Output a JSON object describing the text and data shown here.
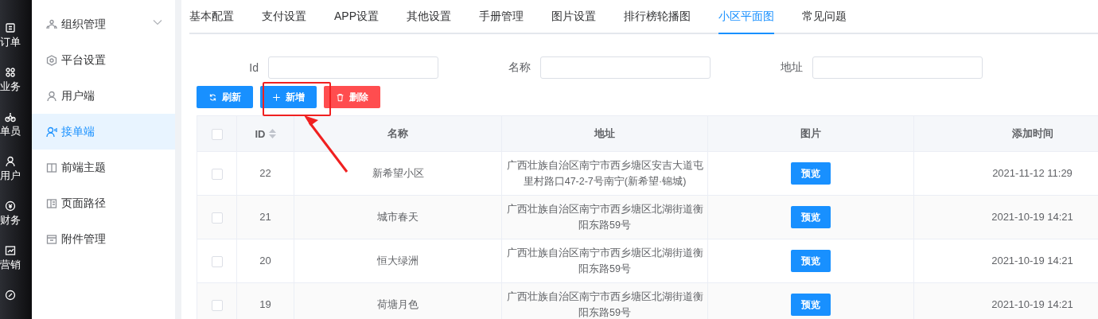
{
  "rail": [
    {
      "label": "订单"
    },
    {
      "label": "业务"
    },
    {
      "label": "单员"
    },
    {
      "label": "用户"
    },
    {
      "label": "财务"
    },
    {
      "label": "营销"
    }
  ],
  "sidebar": {
    "items": [
      {
        "label": "组织管理",
        "kind": "group",
        "selected": false
      },
      {
        "label": "平台设置",
        "kind": "link",
        "selected": false
      },
      {
        "label": "用户端",
        "kind": "link",
        "selected": false
      },
      {
        "label": "接单端",
        "kind": "link",
        "selected": true
      },
      {
        "label": "前端主题",
        "kind": "link",
        "selected": false
      },
      {
        "label": "页面路径",
        "kind": "link",
        "selected": false
      },
      {
        "label": "附件管理",
        "kind": "link",
        "selected": false
      }
    ]
  },
  "tabs": [
    {
      "label": "基本配置",
      "selected": false
    },
    {
      "label": "支付设置",
      "selected": false
    },
    {
      "label": "APP设置",
      "selected": false
    },
    {
      "label": "其他设置",
      "selected": false
    },
    {
      "label": "手册管理",
      "selected": false
    },
    {
      "label": "图片设置",
      "selected": false
    },
    {
      "label": "排行榜轮播图",
      "selected": false
    },
    {
      "label": "小区平面图",
      "selected": true
    },
    {
      "label": "常见问题",
      "selected": false
    }
  ],
  "filters": [
    {
      "label": "Id"
    },
    {
      "label": "名称"
    },
    {
      "label": "地址"
    }
  ],
  "buttons": [
    {
      "label": "刷新",
      "kind": "refresh"
    },
    {
      "label": "新增",
      "kind": "add"
    },
    {
      "label": "删除",
      "kind": "delete"
    }
  ],
  "table": {
    "select_all": {
      "checked": false
    },
    "columns": [
      {
        "label": "ID",
        "sortable": true
      },
      {
        "label": "名称",
        "sortable": false
      },
      {
        "label": "地址",
        "sortable": false
      },
      {
        "label": "图片",
        "sortable": false
      },
      {
        "label": "添加时间",
        "sortable": false
      }
    ],
    "rows": [
      {
        "checked": false,
        "id": "22",
        "name": "新希望小区",
        "address": "广西壮族自治区南宁市西乡塘区安吉大道屯里村路口47-2-7号南宁(新希望·锦城)",
        "image_button": "预览",
        "added": "2021-11-12 11:29"
      },
      {
        "checked": false,
        "id": "21",
        "name": "城市春天",
        "address": "广西壮族自治区南宁市西乡塘区北湖街道衡阳东路59号",
        "image_button": "预览",
        "added": "2021-10-19 14:21"
      },
      {
        "checked": false,
        "id": "20",
        "name": "恒大绿洲",
        "address": "广西壮族自治区南宁市西乡塘区北湖街道衡阳东路59号",
        "image_button": "预览",
        "added": "2021-10-19 14:21"
      },
      {
        "checked": false,
        "id": "19",
        "name": "荷塘月色",
        "address": "广西壮族自治区南宁市西乡塘区北湖街道衡阳东路59号",
        "image_button": "预览",
        "added": "2021-10-19 14:21"
      }
    ]
  }
}
